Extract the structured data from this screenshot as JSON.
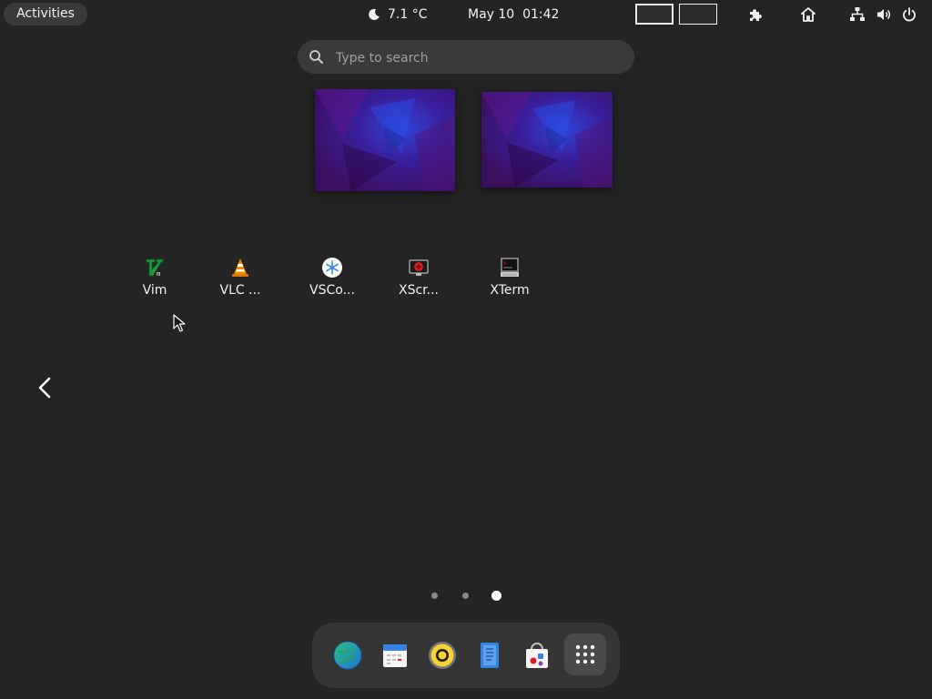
{
  "topbar": {
    "activities_label": "Activities",
    "weather": {
      "temperature": "7.1 °C",
      "icon": "moon-icon"
    },
    "clock": "May 10  01:42",
    "status_icons": [
      "extensions-icon",
      "home-icon",
      "network-icon",
      "volume-icon",
      "power-icon"
    ]
  },
  "search": {
    "placeholder": "Type to search",
    "value": ""
  },
  "workspaces": {
    "count": 2
  },
  "apps": [
    {
      "label": "Vim",
      "icon": "vim-icon"
    },
    {
      "label": "VLC ...",
      "icon": "vlc-icon"
    },
    {
      "label": "VSCo...",
      "icon": "vscode-icon"
    },
    {
      "label": "XScr...",
      "icon": "xscreensaver-icon"
    },
    {
      "label": "XTerm",
      "icon": "xterm-icon"
    }
  ],
  "pagination": {
    "pages": 3,
    "current": 3
  },
  "dash": {
    "items": [
      "web-browser-icon",
      "calendar-icon",
      "rhythmbox-icon",
      "text-editor-icon",
      "software-store-icon"
    ],
    "show_apps_icon": "app-grid-icon"
  },
  "colors": {
    "background": "#242424",
    "panel_pill": "#3a3a3a",
    "dash_background": "#353535",
    "accent_blue": "#3584e4",
    "wallpaper_purple": "#4b1a8a"
  }
}
